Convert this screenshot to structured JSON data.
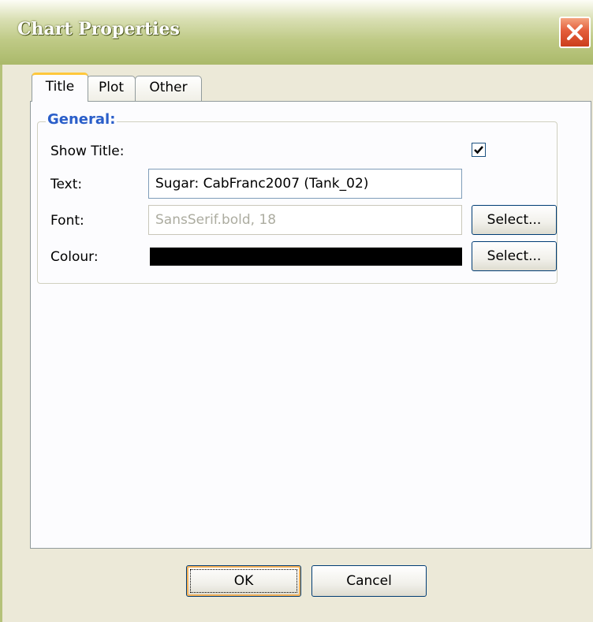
{
  "window": {
    "title": "Chart Properties"
  },
  "tabs": [
    {
      "label": "Title",
      "active": true
    },
    {
      "label": "Plot",
      "active": false
    },
    {
      "label": "Other",
      "active": false
    }
  ],
  "general": {
    "legend": "General:",
    "show_title": {
      "label": "Show Title:",
      "checked": true
    },
    "text": {
      "label": "Text:",
      "value": "Sugar: CabFranc2007 (Tank_02)"
    },
    "font": {
      "label": "Font:",
      "value": "SansSerif.bold, 18",
      "select_label": "Select..."
    },
    "colour": {
      "label": "Colour:",
      "value": "#000000",
      "select_label": "Select..."
    }
  },
  "buttons": {
    "ok": "OK",
    "cancel": "Cancel"
  },
  "colors": {
    "accent": "#2a5ec9",
    "titlebar": "#bfca86",
    "close": "#e45d3a"
  }
}
